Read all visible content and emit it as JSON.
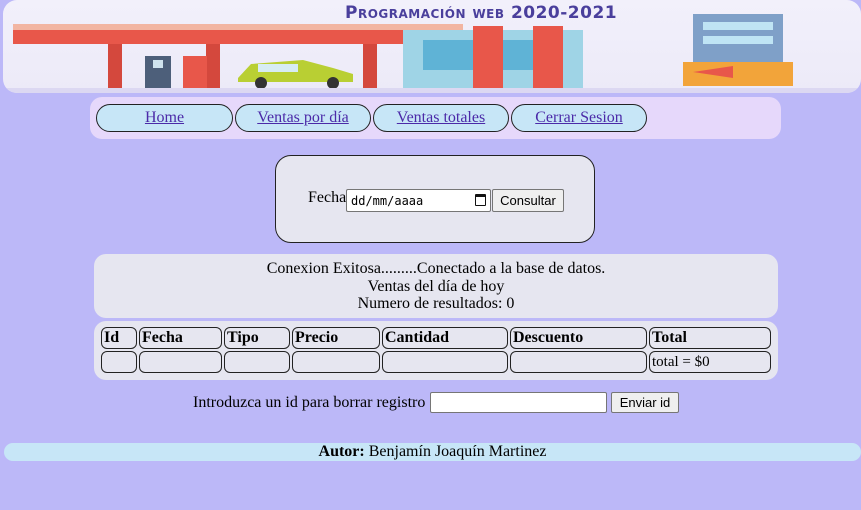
{
  "banner": {
    "title": "Programación web 2020-2021"
  },
  "nav": {
    "items": [
      "Home",
      "Ventas por día",
      "Ventas totales",
      "Cerrar Sesion"
    ]
  },
  "date_form": {
    "label": "Fecha",
    "placeholder": "dd/mm/aaaa",
    "button": "Consultar"
  },
  "status": {
    "line1": "Conexion Exitosa.........Conectado a la base de datos.",
    "line2": "Ventas del día de hoy",
    "line3": "Numero de resultados: 0"
  },
  "table": {
    "headers": [
      "Id",
      "Fecha",
      "Tipo",
      "Precio",
      "Cantidad",
      "Descuento",
      "Total"
    ],
    "total_text": "total = $0"
  },
  "delete_form": {
    "label": "Introduzca un id para borrar registro",
    "button": "Enviar id"
  },
  "footer": {
    "author_label": "Autor:",
    "author_name": "Benjamín Joaquín Martinez"
  },
  "colors": {
    "page_bg": "#bcb8f8",
    "nav_bg": "#e6d8fb",
    "button_bg": "#c7e6f7",
    "link": "#4b2aa8"
  }
}
